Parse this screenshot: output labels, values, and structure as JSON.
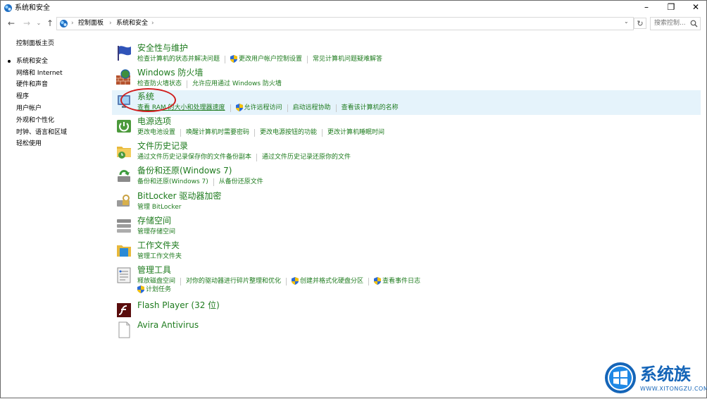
{
  "window": {
    "title": "系统和安全",
    "controls": {
      "minimize": "–",
      "maximize": "❐",
      "close": "✕"
    }
  },
  "navbar": {
    "back": "←",
    "forward": "→",
    "recent": "⌄",
    "up": "↑",
    "breadcrumbs": [
      "控制面板",
      "系统和安全"
    ],
    "separator": "›",
    "dropdown": "⌄",
    "refresh": "↻",
    "search_placeholder": "搜索控制..."
  },
  "sidebar": {
    "home": "控制面板主页",
    "items": [
      "系统和安全",
      "网络和 Internet",
      "硬件和声音",
      "程序",
      "用户帐户",
      "外观和个性化",
      "时钟、语言和区域",
      "轻松使用"
    ],
    "selected_index": 0
  },
  "categories": [
    {
      "title": "安全性与维护",
      "icon": "flag-icon",
      "links": [
        {
          "text": "检查计算机的状态并解决问题"
        },
        {
          "text": "更改用户帐户控制设置",
          "shield": true
        },
        {
          "text": "常见计算机问题疑难解答"
        }
      ]
    },
    {
      "title": "Windows 防火墙",
      "icon": "firewall-icon",
      "links": [
        {
          "text": "检查防火墙状态"
        },
        {
          "text": "允许应用通过 Windows 防火墙"
        }
      ]
    },
    {
      "title": "系统",
      "icon": "system-icon",
      "highlight": true,
      "links": [
        {
          "text": "查看 RAM 的大小和处理器速度",
          "underline": true
        },
        {
          "text": "允许远程访问",
          "shield": true
        },
        {
          "text": "启动远程协助"
        },
        {
          "text": "查看该计算机的名称"
        }
      ]
    },
    {
      "title": "电源选项",
      "icon": "power-icon",
      "links": [
        {
          "text": "更改电池设置"
        },
        {
          "text": "唤醒计算机时需要密码"
        },
        {
          "text": "更改电源按钮的功能"
        },
        {
          "text": "更改计算机睡眠时间"
        }
      ]
    },
    {
      "title": "文件历史记录",
      "icon": "file-history-icon",
      "links": [
        {
          "text": "通过文件历史记录保存你的文件备份副本"
        },
        {
          "text": "通过文件历史记录还原你的文件"
        }
      ]
    },
    {
      "title": "备份和还原(Windows 7)",
      "icon": "backup-icon",
      "links": [
        {
          "text": "备份和还原(Windows 7)"
        },
        {
          "text": "从备份还原文件"
        }
      ]
    },
    {
      "title": "BitLocker 驱动器加密",
      "icon": "bitlocker-icon",
      "links": [
        {
          "text": "管理 BitLocker"
        }
      ]
    },
    {
      "title": "存储空间",
      "icon": "storage-icon",
      "links": [
        {
          "text": "管理存储空间"
        }
      ]
    },
    {
      "title": "工作文件夹",
      "icon": "work-folders-icon",
      "links": [
        {
          "text": "管理工作文件夹"
        }
      ]
    },
    {
      "title": "管理工具",
      "icon": "admin-tools-icon",
      "links": [
        {
          "text": "释放磁盘空间"
        },
        {
          "text": "对你的驱动器进行碎片整理和优化"
        },
        {
          "text": "创建并格式化硬盘分区",
          "shield": true
        },
        {
          "text": "查看事件日志",
          "shield": true
        }
      ],
      "links2": [
        {
          "text": "计划任务",
          "shield": true
        }
      ]
    },
    {
      "title": "Flash Player (32 位)",
      "icon": "flash-icon",
      "links": []
    },
    {
      "title": "Avira Antivirus",
      "icon": "blank-document-icon",
      "links": []
    }
  ],
  "watermark": {
    "text": "系统族",
    "url": "WWW.XITONGZU.COM"
  },
  "colors": {
    "link_green": "#1e7b1e",
    "highlight": "#e5f3fb",
    "annotation_red": "#d01d1d",
    "watermark_blue": "#1565b8"
  }
}
